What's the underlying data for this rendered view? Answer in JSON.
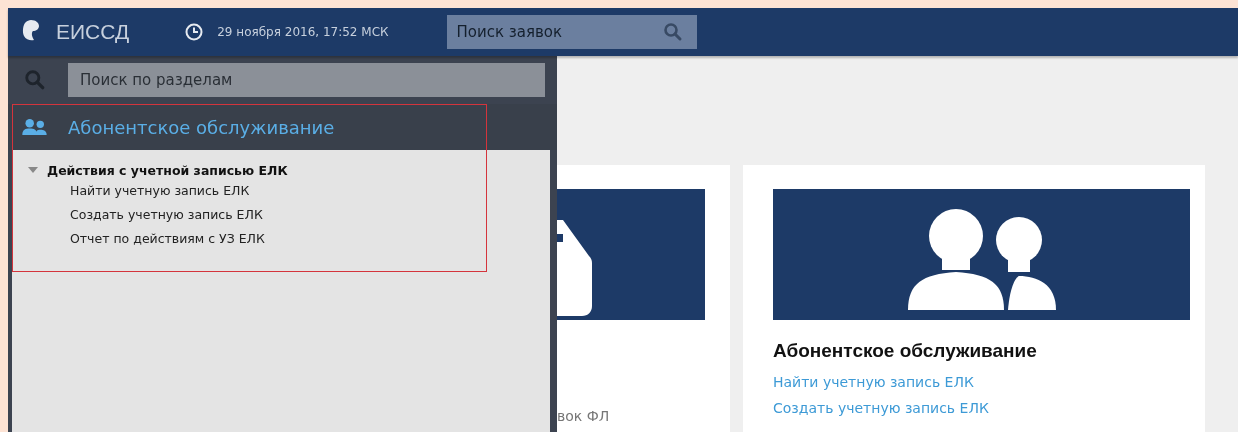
{
  "header": {
    "logo_text": "ЕИССД",
    "datetime": "29 ноября 2016, 17:52 МСК",
    "search": {
      "placeholder": "Поиск заявок"
    }
  },
  "sidebar": {
    "search": {
      "placeholder": "Поиск по разделам"
    },
    "section_title": "Абонентское обслуживание",
    "highlighted": true,
    "tree": [
      {
        "label": "Действия с учетной записью ЕЛК",
        "expanded": true,
        "children": [
          {
            "label": "Найти учетную запись ЕЛК"
          },
          {
            "label": "Создать учетную запись ЕЛК"
          },
          {
            "label": "Отчет по действиям с УЗ ЕЛК"
          }
        ]
      }
    ]
  },
  "cards": [
    {
      "links": [
        {
          "text": "вок ФЛ",
          "disabled": true
        }
      ]
    },
    {
      "title": "Абонентское обслуживание",
      "links": [
        {
          "text": "Найти учетную запись ЕЛК",
          "disabled": false
        },
        {
          "text": "Создать учетную запись ЕЛК",
          "disabled": false
        }
      ]
    }
  ]
}
